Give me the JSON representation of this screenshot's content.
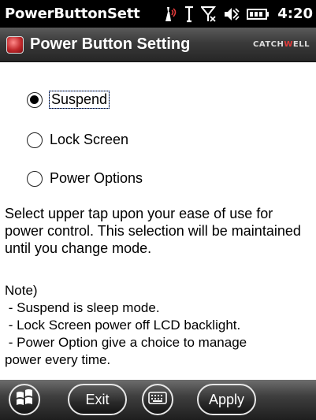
{
  "statusbar": {
    "app_title": "PowerButtonSett",
    "time": "4:20",
    "icons": [
      "connectivity-icon",
      "signal-antenna-icon",
      "no-signal-icon",
      "volume-icon",
      "battery-icon"
    ]
  },
  "titlebar": {
    "title": "Power Button Setting",
    "icon": "power-button-app-icon",
    "brand_prefix": "CATCH",
    "brand_accent": "W",
    "brand_suffix": "ELL"
  },
  "options": [
    {
      "label": "Suspend",
      "checked": true
    },
    {
      "label": "Lock Screen",
      "checked": false
    },
    {
      "label": "Power Options",
      "checked": false
    }
  ],
  "description": "Select upper tap upon your ease of use for power control. This selection will be maintained until you change mode.",
  "note": {
    "heading": "Note)",
    "lines": [
      " - Suspend is sleep mode.",
      " - Lock Screen power off LCD backlight.",
      " - Power Option give a choice to manage",
      "power every time."
    ]
  },
  "bottombar": {
    "start_icon": "windows-start-icon",
    "exit_label": "Exit",
    "keyboard_icon": "keyboard-icon",
    "apply_label": "Apply"
  },
  "colors": {
    "accent_red": "#e23b3b",
    "focus_ring": "#6a8ee6"
  }
}
